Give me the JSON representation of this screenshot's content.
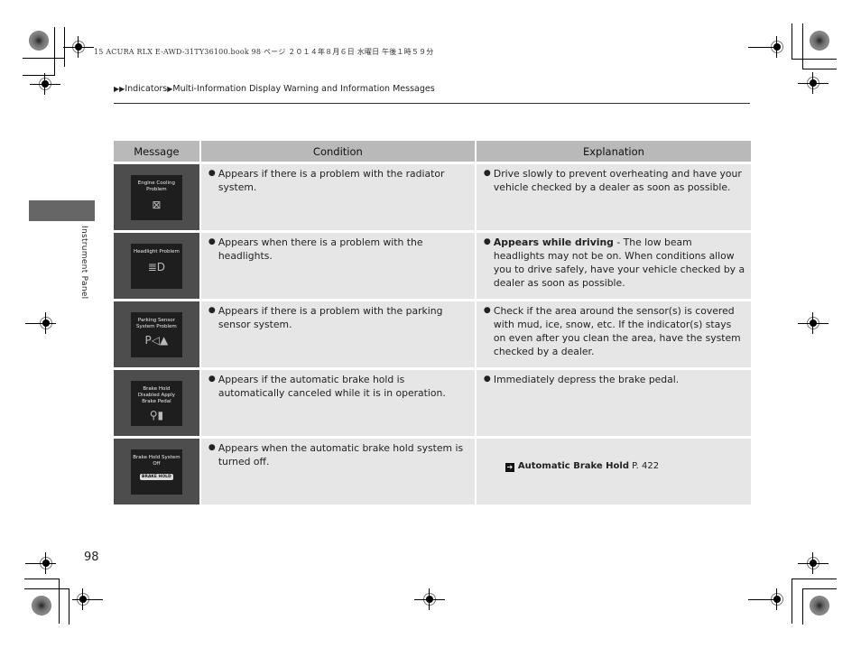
{
  "print_header": "15 ACURA RLX E-AWD-31TY36100.book  98 ページ  ２０１４年８月６日  水曜日  午後１時５９分",
  "breadcrumb": {
    "marker": "▶▶",
    "items": [
      "Indicators",
      "Multi-Information Display Warning and Information Messages"
    ],
    "separator": "▶"
  },
  "side_label": "Instrument Panel",
  "page_number": "98",
  "table": {
    "headers": [
      "Message",
      "Condition",
      "Explanation"
    ],
    "rows": [
      {
        "message_screen": "Engine Cooling Problem",
        "message_icon": "radiator-icon",
        "message_icon_glyph": "⊠",
        "condition": "Appears if there is a problem with the radiator system.",
        "explanation_bold": "",
        "explanation": "Drive slowly to prevent overheating and have your vehicle checked by a dealer as soon as possible."
      },
      {
        "message_screen": "Headlight Problem",
        "message_icon": "headlight-icon",
        "message_icon_glyph": "≣D",
        "condition": "Appears when there is a problem with the headlights.",
        "explanation_bold": "Appears while driving",
        "explanation": " - The low beam headlights may not be on. When conditions allow you to drive safely, have your vehicle checked by a dealer as soon as possible."
      },
      {
        "message_screen": "Parking Sensor System Problem",
        "message_icon": "parking-sensor-icon",
        "message_icon_glyph": "P◁▲",
        "condition": "Appears if there is a problem with the parking sensor system.",
        "explanation_bold": "",
        "explanation": "Check if the area around the sensor(s) is covered with mud, ice, snow, etc. If the indicator(s) stays on even after you clean the area, have the system checked by a dealer."
      },
      {
        "message_screen": "Brake Hold Disabled Apply Brake Pedal",
        "message_icon": "brake-pedal-icon",
        "message_icon_glyph": "⚲▮",
        "condition": "Appears if the automatic brake hold is automatically canceled while it is in operation.",
        "explanation_bold": "",
        "explanation": "Immediately depress the brake pedal."
      },
      {
        "message_screen": "Brake Hold System Off",
        "message_icon": "brake-hold-icon",
        "message_icon_glyph": "BRAKE HOLD",
        "condition": "Appears when the automatic brake hold system is turned off.",
        "xref_title": "Automatic Brake Hold",
        "xref_page": "P. 422"
      }
    ]
  }
}
